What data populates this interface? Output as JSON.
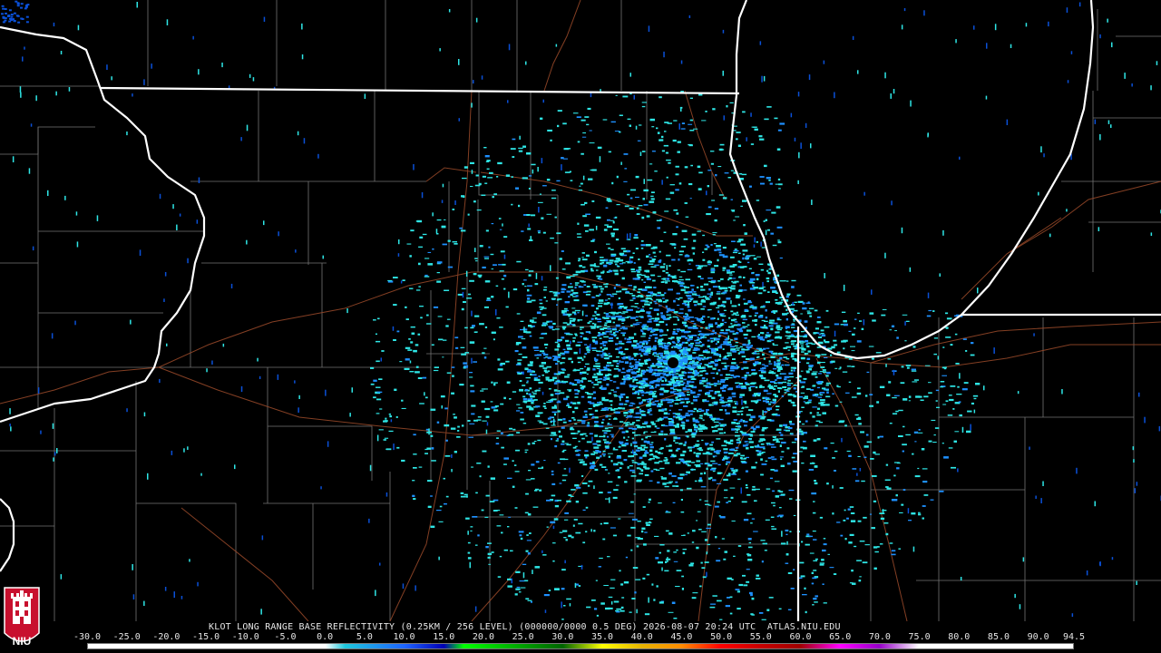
{
  "product": {
    "caption": "KLOT LONG RANGE BASE REFLECTIVITY (0.25KM / 256 LEVEL) (000000/0000 0.5 DEG) 2026-08-07 20:24 UTC  ATLAS.NIU.EDU",
    "station": "KLOT",
    "product_name": "LONG RANGE BASE REFLECTIVITY",
    "timestamp": "2026-08-07 20:24 UTC",
    "site": "ATLAS.NIU.EDU"
  },
  "colorbar": {
    "ticks": [
      "-30.0",
      "-25.0",
      "-20.0",
      "-15.0",
      "-10.0",
      "-5.0",
      "0.0",
      "5.0",
      "10.0",
      "15.0",
      "20.0",
      "25.0",
      "30.0",
      "35.0",
      "40.0",
      "45.0",
      "50.0",
      "55.0",
      "60.0",
      "65.0",
      "70.0",
      "75.0",
      "80.0",
      "85.0",
      "90.0",
      "94.5"
    ],
    "min": -30.0,
    "max": 94.5,
    "stops": [
      {
        "value": -30,
        "color": "#ffffff"
      },
      {
        "value": 0,
        "color": "#ffffff"
      },
      {
        "value": 2.5,
        "color": "#1ec8dc"
      },
      {
        "value": 10,
        "color": "#1e64ff"
      },
      {
        "value": 15,
        "color": "#0000b4"
      },
      {
        "value": 17.5,
        "color": "#00ff00"
      },
      {
        "value": 25,
        "color": "#00a000"
      },
      {
        "value": 30,
        "color": "#006400"
      },
      {
        "value": 35,
        "color": "#ffff00"
      },
      {
        "value": 40,
        "color": "#e6b400"
      },
      {
        "value": 45,
        "color": "#ff8c00"
      },
      {
        "value": 50,
        "color": "#ff0000"
      },
      {
        "value": 55,
        "color": "#c80000"
      },
      {
        "value": 60,
        "color": "#a00000"
      },
      {
        "value": 65,
        "color": "#ff00ff"
      },
      {
        "value": 70,
        "color": "#9600c8"
      },
      {
        "value": 75,
        "color": "#ffffff"
      },
      {
        "value": 94.5,
        "color": "#ffffff"
      }
    ]
  },
  "logo": {
    "text": "NIU",
    "color": "#c8102e"
  },
  "colors": {
    "state_border": "#ffffff",
    "county_line": "#a0a0a0",
    "road": "#a0522d",
    "echo_light": "#2ee6e6",
    "echo_mid": "#1e90ff",
    "echo_dark": "#0a50d8"
  }
}
